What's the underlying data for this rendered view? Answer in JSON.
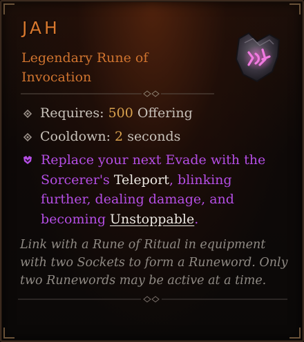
{
  "item": {
    "name": "JAH",
    "subtitle": "Legendary Rune of Invocation",
    "icon": "rune-jah-icon"
  },
  "stats": {
    "requires_label": "Requires:",
    "requires_value": "500",
    "requires_unit": "Offering",
    "cooldown_label": "Cooldown:",
    "cooldown_value": "2",
    "cooldown_unit": "seconds"
  },
  "power": {
    "part1": "Replace your next Evade with the Sorcerer's ",
    "skill": "Teleport",
    "part2": ", blinking further, dealing damage, and becoming ",
    "keyword": "Unstoppable",
    "part3": "."
  },
  "flavor": "Link with a Rune of Ritual in equipment with two Sockets to form a Runeword. Only two Runewords may be active at a time.",
  "colors": {
    "legendary": "#d9782e",
    "value": "#d9a24e",
    "power": "#b54ee5",
    "flavor": "#8f8a84"
  }
}
